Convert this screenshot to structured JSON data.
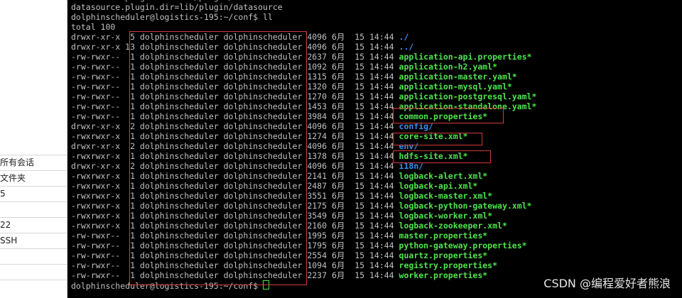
{
  "sidebar": {
    "items": [
      "所有会话",
      "文件夹",
      "5",
      "",
      "22",
      "SSH",
      "",
      ""
    ]
  },
  "terminal": {
    "lines": [
      {
        "text": "datasource.plugin.dir=lib/plugin/datasource"
      },
      {
        "text": "datasource.plugin.dir=lib/plugin/datasource"
      },
      {
        "text": "dolphinscheduler@logistics-195:~/conf$ ll"
      },
      {
        "text": "total 100"
      },
      {
        "perm": "drwxr-xr-x",
        "links": " 5",
        "owner": "dolphinscheduler",
        "group": "dolphinscheduler",
        "size": "4096",
        "month": "6月",
        "day": "15",
        "time": "14:44",
        "name": "./",
        "type": "dir"
      },
      {
        "perm": "drwxr-xr-x",
        "links": "13",
        "owner": "dolphinscheduler",
        "group": "dolphinscheduler",
        "size": "4096",
        "month": "6月",
        "day": "15",
        "time": "14:44",
        "name": "../",
        "type": "dir"
      },
      {
        "perm": "-rw-rwxr--",
        "links": " 1",
        "owner": "dolphinscheduler",
        "group": "dolphinscheduler",
        "size": "2637",
        "month": "6月",
        "day": "15",
        "time": "14:44",
        "name": "application-api.properties*",
        "type": "exec"
      },
      {
        "perm": "-rw-rwxr--",
        "links": " 1",
        "owner": "dolphinscheduler",
        "group": "dolphinscheduler",
        "size": "1092",
        "month": "6月",
        "day": "15",
        "time": "14:44",
        "name": "application-h2.yaml*",
        "type": "exec"
      },
      {
        "perm": "-rw-rwxr--",
        "links": " 1",
        "owner": "dolphinscheduler",
        "group": "dolphinscheduler",
        "size": "1315",
        "month": "6月",
        "day": "15",
        "time": "14:44",
        "name": "application-master.yaml*",
        "type": "exec"
      },
      {
        "perm": "-rw-rwxr--",
        "links": " 1",
        "owner": "dolphinscheduler",
        "group": "dolphinscheduler",
        "size": "1320",
        "month": "6月",
        "day": "15",
        "time": "14:44",
        "name": "application-mysql.yaml*",
        "type": "exec"
      },
      {
        "perm": "-rw-rwxr--",
        "links": " 1",
        "owner": "dolphinscheduler",
        "group": "dolphinscheduler",
        "size": "1270",
        "month": "6月",
        "day": "15",
        "time": "14:44",
        "name": "application-postgresql.yaml*",
        "type": "exec"
      },
      {
        "perm": "-rw-rwxr--",
        "links": " 1",
        "owner": "dolphinscheduler",
        "group": "dolphinscheduler",
        "size": "1453",
        "month": "6月",
        "day": "15",
        "time": "14:44",
        "name": "application-standalone.yaml*",
        "type": "exec"
      },
      {
        "perm": "-rw-rwxr--",
        "links": " 1",
        "owner": "dolphinscheduler",
        "group": "dolphinscheduler",
        "size": "3984",
        "month": "6月",
        "day": "15",
        "time": "14:44",
        "name": "common.properties*",
        "type": "exec"
      },
      {
        "perm": "drwxr-xr-x",
        "links": " 2",
        "owner": "dolphinscheduler",
        "group": "dolphinscheduler",
        "size": "4096",
        "month": "6月",
        "day": "15",
        "time": "14:44",
        "name": "config/",
        "type": "dir"
      },
      {
        "perm": "-rwxrwxr-x",
        "links": " 1",
        "owner": "dolphinscheduler",
        "group": "dolphinscheduler",
        "size": "1274",
        "month": "6月",
        "day": "15",
        "time": "14:44",
        "name": "core-site.xml*",
        "type": "exec"
      },
      {
        "perm": "drwxr-xr-x",
        "links": " 2",
        "owner": "dolphinscheduler",
        "group": "dolphinscheduler",
        "size": "4096",
        "month": "6月",
        "day": "15",
        "time": "14:44",
        "name": "env/",
        "type": "dir"
      },
      {
        "perm": "-rwxrwxr-x",
        "links": " 1",
        "owner": "dolphinscheduler",
        "group": "dolphinscheduler",
        "size": "1378",
        "month": "6月",
        "day": "15",
        "time": "14:44",
        "name": "hdfs-site.xml*",
        "type": "exec"
      },
      {
        "perm": "drwxr-xr-x",
        "links": " 2",
        "owner": "dolphinscheduler",
        "group": "dolphinscheduler",
        "size": "4096",
        "month": "6月",
        "day": "15",
        "time": "14:44",
        "name": "i18n/",
        "type": "dir"
      },
      {
        "perm": "-rwxrwxr-x",
        "links": " 1",
        "owner": "dolphinscheduler",
        "group": "dolphinscheduler",
        "size": "2141",
        "month": "6月",
        "day": "15",
        "time": "14:44",
        "name": "logback-alert.xml*",
        "type": "exec"
      },
      {
        "perm": "-rwxrwxr-x",
        "links": " 1",
        "owner": "dolphinscheduler",
        "group": "dolphinscheduler",
        "size": "2487",
        "month": "6月",
        "day": "15",
        "time": "14:44",
        "name": "logback-api.xml*",
        "type": "exec"
      },
      {
        "perm": "-rwxrwxr-x",
        "links": " 1",
        "owner": "dolphinscheduler",
        "group": "dolphinscheduler",
        "size": "3551",
        "month": "6月",
        "day": "15",
        "time": "14:44",
        "name": "logback-master.xml*",
        "type": "exec"
      },
      {
        "perm": "-rwxrwxr-x",
        "links": " 1",
        "owner": "dolphinscheduler",
        "group": "dolphinscheduler",
        "size": "2175",
        "month": "6月",
        "day": "15",
        "time": "14:44",
        "name": "logback-python-gateway.xml*",
        "type": "exec"
      },
      {
        "perm": "-rwxrwxr-x",
        "links": " 1",
        "owner": "dolphinscheduler",
        "group": "dolphinscheduler",
        "size": "3549",
        "month": "6月",
        "day": "15",
        "time": "14:44",
        "name": "logback-worker.xml*",
        "type": "exec"
      },
      {
        "perm": "-rwxrwxr-x",
        "links": " 1",
        "owner": "dolphinscheduler",
        "group": "dolphinscheduler",
        "size": "2160",
        "month": "6月",
        "day": "15",
        "time": "14:44",
        "name": "logback-zookeeper.xml*",
        "type": "exec"
      },
      {
        "perm": "-rw-rwxr--",
        "links": " 1",
        "owner": "dolphinscheduler",
        "group": "dolphinscheduler",
        "size": "1995",
        "month": "6月",
        "day": "15",
        "time": "14:44",
        "name": "master.properties*",
        "type": "exec"
      },
      {
        "perm": "-rw-rwxr--",
        "links": " 1",
        "owner": "dolphinscheduler",
        "group": "dolphinscheduler",
        "size": "1795",
        "month": "6月",
        "day": "15",
        "time": "14:44",
        "name": "python-gateway.properties*",
        "type": "exec"
      },
      {
        "perm": "-rw-rwxr--",
        "links": " 1",
        "owner": "dolphinscheduler",
        "group": "dolphinscheduler",
        "size": "2554",
        "month": "6月",
        "day": "15",
        "time": "14:44",
        "name": "quartz.properties*",
        "type": "exec"
      },
      {
        "perm": "-rw-rwxr--",
        "links": " 1",
        "owner": "dolphinscheduler",
        "group": "dolphinscheduler",
        "size": "1094",
        "month": "6月",
        "day": "15",
        "time": "14:44",
        "name": "registry.properties*",
        "type": "exec"
      },
      {
        "perm": "-rw-rwxr--",
        "links": " 1",
        "owner": "dolphinscheduler",
        "group": "dolphinscheduler",
        "size": "2237",
        "month": "6月",
        "day": "15",
        "time": "14:44",
        "name": "worker.properties*",
        "type": "exec"
      }
    ],
    "prompt": "dolphinscheduler@logistics-195:~/conf$ "
  },
  "watermark": "CSDN @编程爱好者熊浪",
  "colors": {
    "dir": "#3b8eea",
    "exec": "#4ee44e",
    "highlight": "#d23a3a",
    "text": "#c0c0c0"
  }
}
